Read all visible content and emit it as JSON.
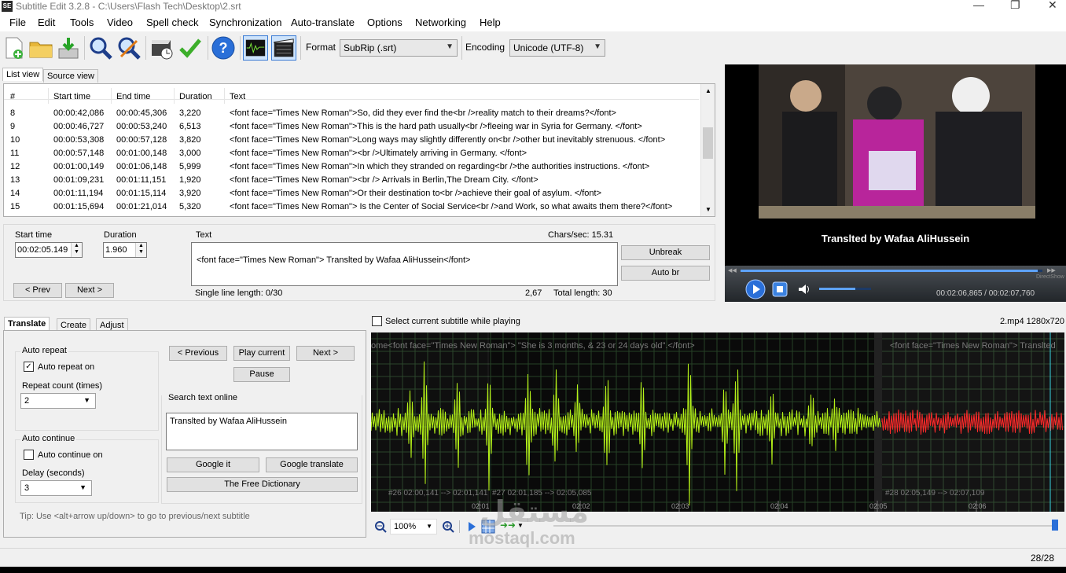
{
  "window": {
    "title": "Subtitle Edit 3.2.8 - C:\\Users\\Flash Tech\\Desktop\\2.srt",
    "app_icon_text": "SE"
  },
  "menu": [
    "File",
    "Edit",
    "Tools",
    "Video",
    "Spell check",
    "Synchronization",
    "Auto-translate",
    "Options",
    "Networking",
    "Help"
  ],
  "toolbar": {
    "format_label": "Format",
    "format_value": "SubRip (.srt)",
    "encoding_label": "Encoding",
    "encoding_value": "Unicode (UTF-8)"
  },
  "view_tabs": [
    "List view",
    "Source view"
  ],
  "list": {
    "columns": [
      "#",
      "Start time",
      "End time",
      "Duration",
      "Text"
    ],
    "rows": [
      {
        "n": "8",
        "start": "00:00:42,086",
        "end": "00:00:45,306",
        "dur": "3,220",
        "text": "<font face=\"Times New Roman\">So, did they ever find the<br />reality match to their dreams?</font>"
      },
      {
        "n": "9",
        "start": "00:00:46,727",
        "end": "00:00:53,240",
        "dur": "6,513",
        "text": "<font face=\"Times New Roman\">This is the hard path usually<br />fleeing war in Syria for Germany. </font>"
      },
      {
        "n": "10",
        "start": "00:00:53,308",
        "end": "00:00:57,128",
        "dur": "3,820",
        "text": "<font face=\"Times New Roman\">Long ways may slightly differently on<br />other but inevitably strenuous. </font>"
      },
      {
        "n": "11",
        "start": "00:00:57,148",
        "end": "00:01:00,148",
        "dur": "3,000",
        "text": "<font face=\"Times New Roman\"><br />Ultimately arriving in Germany. </font>"
      },
      {
        "n": "12",
        "start": "00:01:00,149",
        "end": "00:01:06,148",
        "dur": "5,999",
        "text": "<font face=\"Times New Roman\">In which they stranded on regarding<br />the authorities instructions. </font>"
      },
      {
        "n": "13",
        "start": "00:01:09,231",
        "end": "00:01:11,151",
        "dur": "1,920",
        "text": "<font face=\"Times New Roman\"><br /> Arrivals in Berlin,The Dream City. </font>"
      },
      {
        "n": "14",
        "start": "00:01:11,194",
        "end": "00:01:15,114",
        "dur": "3,920",
        "text": "<font face=\"Times New Roman\">Or their destination to<br />achieve their goal of asylum. </font>"
      },
      {
        "n": "15",
        "start": "00:01:15,694",
        "end": "00:01:21,014",
        "dur": "5,320",
        "text": "<font face=\"Times New Roman\"> Is the Center of Social Service<br />and Work, so what awaits them there?</font>"
      }
    ]
  },
  "edit": {
    "start_time_label": "Start time",
    "start_time": "00:02:05.149",
    "duration_label": "Duration",
    "duration": "1.960",
    "text_label": "Text",
    "chars_sec": "Chars/sec: 15.31",
    "text": "<font face=\"Times New Roman\"> Translted by Wafaa AliHussein</font>",
    "unbreak": "Unbreak",
    "auto_br": "Auto br",
    "prev": "< Prev",
    "next": "Next >",
    "single_line_length": "Single line length: 0/30",
    "ratio": "2,67",
    "total_length": "Total length: 30"
  },
  "video": {
    "caption": "Translted by Wafaa AliHussein",
    "time": "00:02:06,865 / 00:02:07,760",
    "renderer": "DirectShow",
    "progress": 0.985,
    "volume": 0.7
  },
  "bottom_tabs": [
    "Translate",
    "Create",
    "Adjust"
  ],
  "translate": {
    "auto_repeat_group": "Auto repeat",
    "auto_repeat_on": "Auto repeat on",
    "auto_repeat_checked": true,
    "repeat_count_label": "Repeat count (times)",
    "repeat_count": "2",
    "auto_continue_group": "Auto continue",
    "auto_continue_on": "Auto continue on",
    "auto_continue_checked": false,
    "delay_label": "Delay (seconds)",
    "delay": "3",
    "previous": "< Previous",
    "play_current": "Play current",
    "next": "Next >",
    "pause": "Pause",
    "search_online_label": "Search text online",
    "search_text": "Translted by Wafaa AliHussein",
    "google_it": "Google it",
    "google_translate": "Google translate",
    "free_dictionary": "The Free Dictionary",
    "tip": "Tip: Use <alt+arrow up/down> to go to previous/next subtitle"
  },
  "waveform": {
    "select_while_playing": "Select current subtitle while playing",
    "file_info": "2.mp4 1280x720",
    "top_texts": [
      "ome<font face=\"Times New Roman\">    \"She is 3 months, & 23 or 24 days old\".</font>",
      "<font face=\"Times New Roman\"> Translted"
    ],
    "segments": [
      "#26  02:00,141 --> 02:01,141",
      "#27  02:01,185 --> 02:05,085",
      "#28  02:05,149 --> 02:07,109"
    ],
    "ticks": [
      "02:01",
      "02:02",
      "02:03",
      "02:04",
      "02:05",
      "02:06"
    ],
    "zoom": "100%"
  },
  "status": {
    "count": "28/28"
  },
  "watermark": {
    "arabic": "مستقل",
    "latin": "mostaql.com"
  },
  "colors": {
    "wave_green": "#b5f218",
    "wave_red": "#ff2a2a",
    "accent_blue": "#2a6fd8"
  }
}
